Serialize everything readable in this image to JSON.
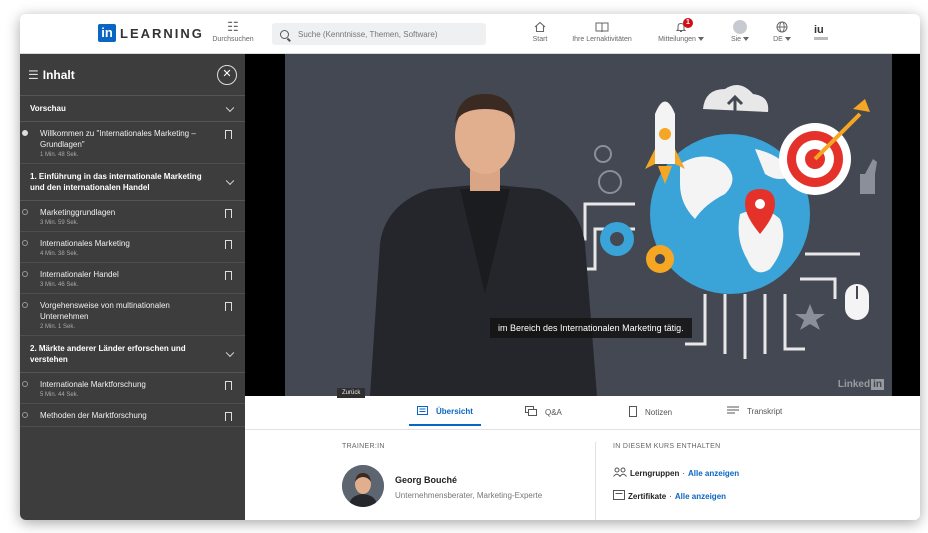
{
  "nav": {
    "logo_in": "in",
    "logo_text": "LEARNING",
    "browse_label": "Durchsuchen",
    "search_placeholder": "Suche (Kenntnisse, Themen, Software)",
    "items": [
      {
        "label": "Start",
        "icon": "home-icon"
      },
      {
        "label": "Ihre Lernaktivitäten",
        "icon": "book-icon"
      },
      {
        "label": "Mitteilungen",
        "icon": "bell-icon",
        "badge": "1"
      },
      {
        "label": "Sie",
        "icon": "avatar"
      },
      {
        "label": "DE",
        "icon": "globe-icon"
      }
    ],
    "brand_right": "iu"
  },
  "sidebar": {
    "title": "Inhalt",
    "sections": [
      {
        "title": "Vorschau",
        "videos": [
          {
            "title": "Willkommen zu \"Internationales Marketing – Grundlagen\"",
            "duration": "1 Min. 48 Sek."
          }
        ]
      },
      {
        "title": "1. Einführung in das internationale Marketing und den internationalen Handel",
        "videos": [
          {
            "title": "Marketinggrundlagen",
            "duration": "3 Min. 59 Sek."
          },
          {
            "title": "Internationales Marketing",
            "duration": "4 Min. 38 Sek."
          },
          {
            "title": "Internationaler Handel",
            "duration": "3 Min. 46 Sek."
          },
          {
            "title": "Vorgehensweise von multinationalen Unternehmen",
            "duration": "2 Min. 1 Sek."
          }
        ]
      },
      {
        "title": "2. Märkte anderer Länder erforschen und verstehen",
        "videos": [
          {
            "title": "Internationale Marktforschung",
            "duration": "5 Min. 44 Sek."
          },
          {
            "title": "Methoden der Marktforschung",
            "duration": ""
          }
        ]
      }
    ]
  },
  "video": {
    "caption": "im Bereich des Internationalen Marketing tätig.",
    "watermark": "Linked",
    "back_tooltip": "Zurück"
  },
  "tabs": [
    {
      "label": "Übersicht",
      "active": true
    },
    {
      "label": "Q&A",
      "active": false
    },
    {
      "label": "Notizen",
      "active": false
    },
    {
      "label": "Transkript",
      "active": false
    }
  ],
  "overview": {
    "trainer_label": "TRAINER:IN",
    "trainer_name": "Georg Bouché",
    "trainer_role": "Unternehmensberater, Marketing-Experte",
    "included_label": "IN DIESEM KURS ENTHALTEN",
    "included": [
      {
        "label": "Lerngruppen",
        "link": "Alle anzeigen"
      },
      {
        "label": "Zertifikate",
        "link": "Alle anzeigen"
      }
    ]
  },
  "colors": {
    "brand": "#0a66c2",
    "sidebar_bg": "#3d3d3d",
    "badge": "#cc1016"
  }
}
